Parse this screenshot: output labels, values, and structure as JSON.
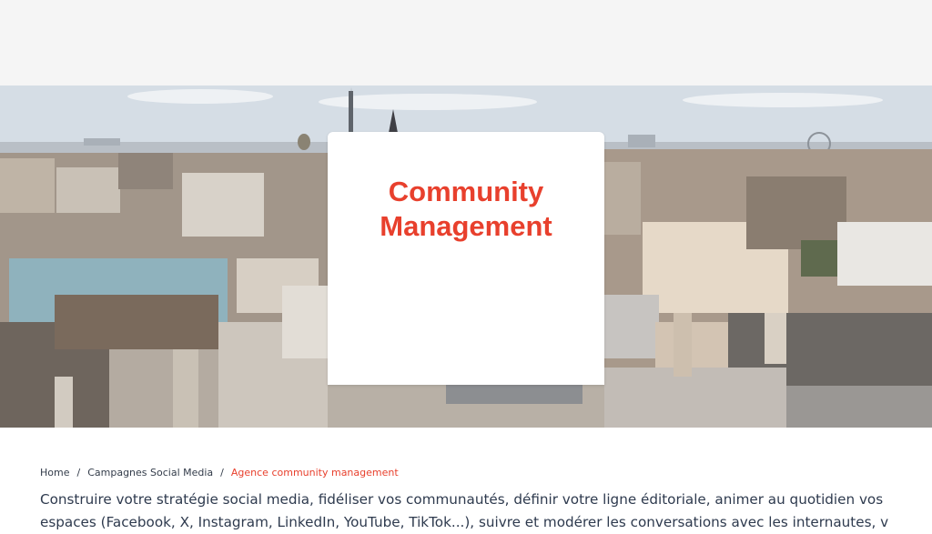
{
  "banner": {
    "title": "Community\nManagement",
    "image_alt": "Paris rooftops panorama with Eiffel Tower"
  },
  "breadcrumb": {
    "items": [
      {
        "label": "Home"
      },
      {
        "label": "Campagnes Social Media"
      },
      {
        "label": "Agence community management"
      }
    ],
    "separator": "/"
  },
  "content": {
    "intro": "Construire votre stratégie social media, fidéliser vos communautés, définir votre ligne éditoriale, animer au quotidien vos espaces (Facebook, X, Instagram, LinkedIn, YouTube, TikTok...), suivre et modérer les conversations avec les internautes, v"
  },
  "colors": {
    "accent": "#e8402d",
    "text": "#2e3a4e",
    "header_bg": "#f5f5f5"
  }
}
